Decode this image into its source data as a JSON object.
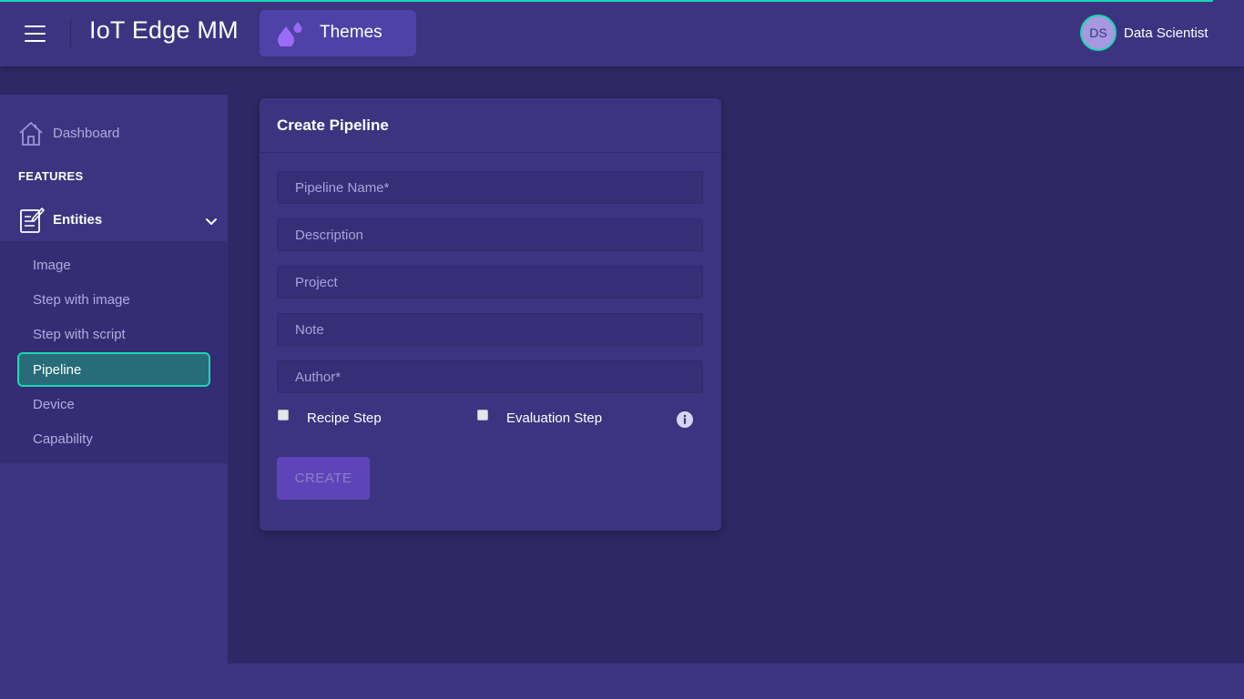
{
  "header": {
    "app_title": "IoT Edge MM",
    "themes_label": "Themes",
    "user": {
      "initials": "DS",
      "name": "Data Scientist"
    }
  },
  "sidebar": {
    "dashboard_label": "Dashboard",
    "features_heading": "FEATURES",
    "entities_label": "Entities",
    "items": [
      {
        "label": "Image"
      },
      {
        "label": "Step with image"
      },
      {
        "label": "Step with script"
      },
      {
        "label": "Pipeline",
        "active": true
      },
      {
        "label": "Device"
      },
      {
        "label": "Capability"
      }
    ]
  },
  "form": {
    "title": "Create Pipeline",
    "fields": [
      {
        "placeholder": "Pipeline Name*",
        "value": ""
      },
      {
        "placeholder": "Description",
        "value": ""
      },
      {
        "placeholder": "Project",
        "value": ""
      },
      {
        "placeholder": "Note",
        "value": ""
      },
      {
        "placeholder": "Author*",
        "value": ""
      }
    ],
    "checkboxes": [
      {
        "label": "Recipe Step",
        "checked": false
      },
      {
        "label": "Evaluation Step",
        "checked": false
      }
    ],
    "create_label": "CREATE"
  },
  "colors": {
    "accent": "#19d7b4",
    "header_bg": "#3c3480",
    "page_bg": "#2e2866",
    "themes_button": "#4f42a6",
    "active_item_bg": "#276c78",
    "create_button": "#5e44b8"
  },
  "icons": {
    "menu": "hamburger-icon",
    "themes": "droplets-icon",
    "dashboard": "home-icon",
    "entities": "edit-document-icon",
    "expand": "chevron-down-icon",
    "info": "info-icon"
  }
}
